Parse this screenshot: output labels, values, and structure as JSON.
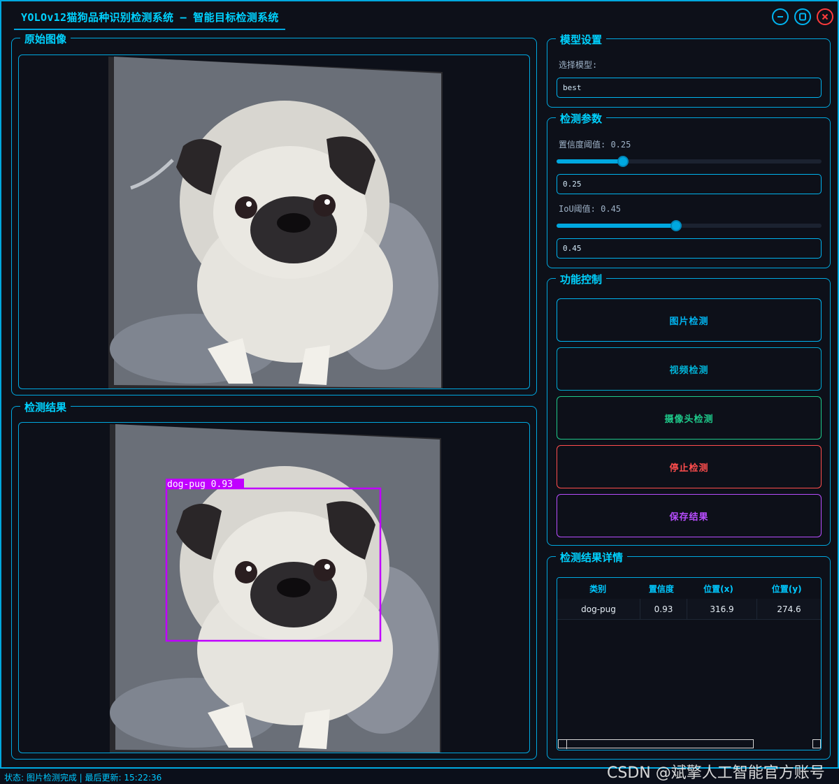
{
  "window": {
    "title": "YOLOv12猫狗品种识别检测系统 – 智能目标检测系统"
  },
  "panels": {
    "original_title": "原始图像",
    "result_title": "检测结果"
  },
  "detection_overlay": {
    "label": "dog-pug 0.93",
    "color": "#c000ff"
  },
  "model_settings": {
    "title": "模型设置",
    "select_label": "选择模型:",
    "selected_model": "best"
  },
  "detection_params": {
    "title": "检测参数",
    "confidence_label": "置信度阈值: 0.25",
    "confidence_value": "0.25",
    "confidence_fraction": 0.25,
    "iou_label": "IoU阈值: 0.45",
    "iou_value": "0.45",
    "iou_fraction": 0.45
  },
  "function_control": {
    "title": "功能控制",
    "buttons": [
      {
        "label": "图片检测",
        "color": "#00b4f0"
      },
      {
        "label": "视频检测",
        "color": "#00b4d8"
      },
      {
        "label": "摄像头检测",
        "color": "#1ec98a"
      },
      {
        "label": "停止检测",
        "color": "#ff4d4d"
      },
      {
        "label": "保存结果",
        "color": "#b84dff"
      }
    ]
  },
  "results_details": {
    "title": "检测结果详情",
    "columns": [
      "类别",
      "置信度",
      "位置(x)",
      "位置(y)"
    ],
    "rows": [
      [
        "dog-pug",
        "0.93",
        "316.9",
        "274.6"
      ]
    ]
  },
  "status": {
    "text": "状态: 图片检测完成 | 最后更新: 15:22:36"
  },
  "watermark": "CSDN @斌擎人工智能官方账号",
  "icons": {
    "minimize": "minimize-icon",
    "maximize": "maximize-icon",
    "close": "close-icon"
  },
  "colors": {
    "accent": "#00a8e0",
    "title": "#00d2ff",
    "background": "#0d1019"
  }
}
